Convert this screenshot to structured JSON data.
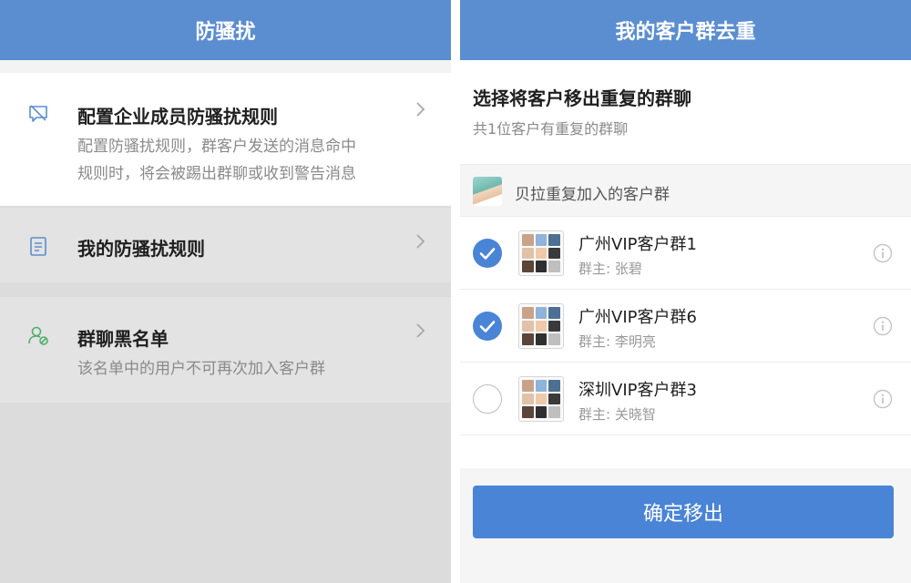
{
  "left": {
    "nav_title": "防骚扰",
    "items": [
      {
        "title": "配置企业成员防骚扰规则",
        "desc_line1": "配置防骚扰规则，群客户发送的消息命中",
        "desc_line2": "规则时，将会被踢出群聊或收到警告消息",
        "icon": "no-message-icon"
      },
      {
        "title": "我的防骚扰规则",
        "icon": "clipboard-icon"
      },
      {
        "title": "群聊黑名单",
        "desc": "该名单中的用户不可再次加入客户群",
        "icon": "user-blocked-icon"
      }
    ]
  },
  "right": {
    "nav_title": "我的客户群去重",
    "heading": "选择将客户移出重复的群聊",
    "subheading": "共1位客户有重复的群聊",
    "group_header": "贝拉重复加入的客户群",
    "groups": [
      {
        "name": "广州VIP客户群1",
        "owner": "群主: 张碧",
        "checked": true
      },
      {
        "name": "广州VIP客户群6",
        "owner": "群主: 李明亮",
        "checked": true
      },
      {
        "name": "深圳VIP客户群3",
        "owner": "群主: 关晓智",
        "checked": false
      }
    ],
    "button": "确定移出"
  },
  "colors": {
    "nav": "#5b8ed0",
    "accent": "#4a84d6"
  }
}
